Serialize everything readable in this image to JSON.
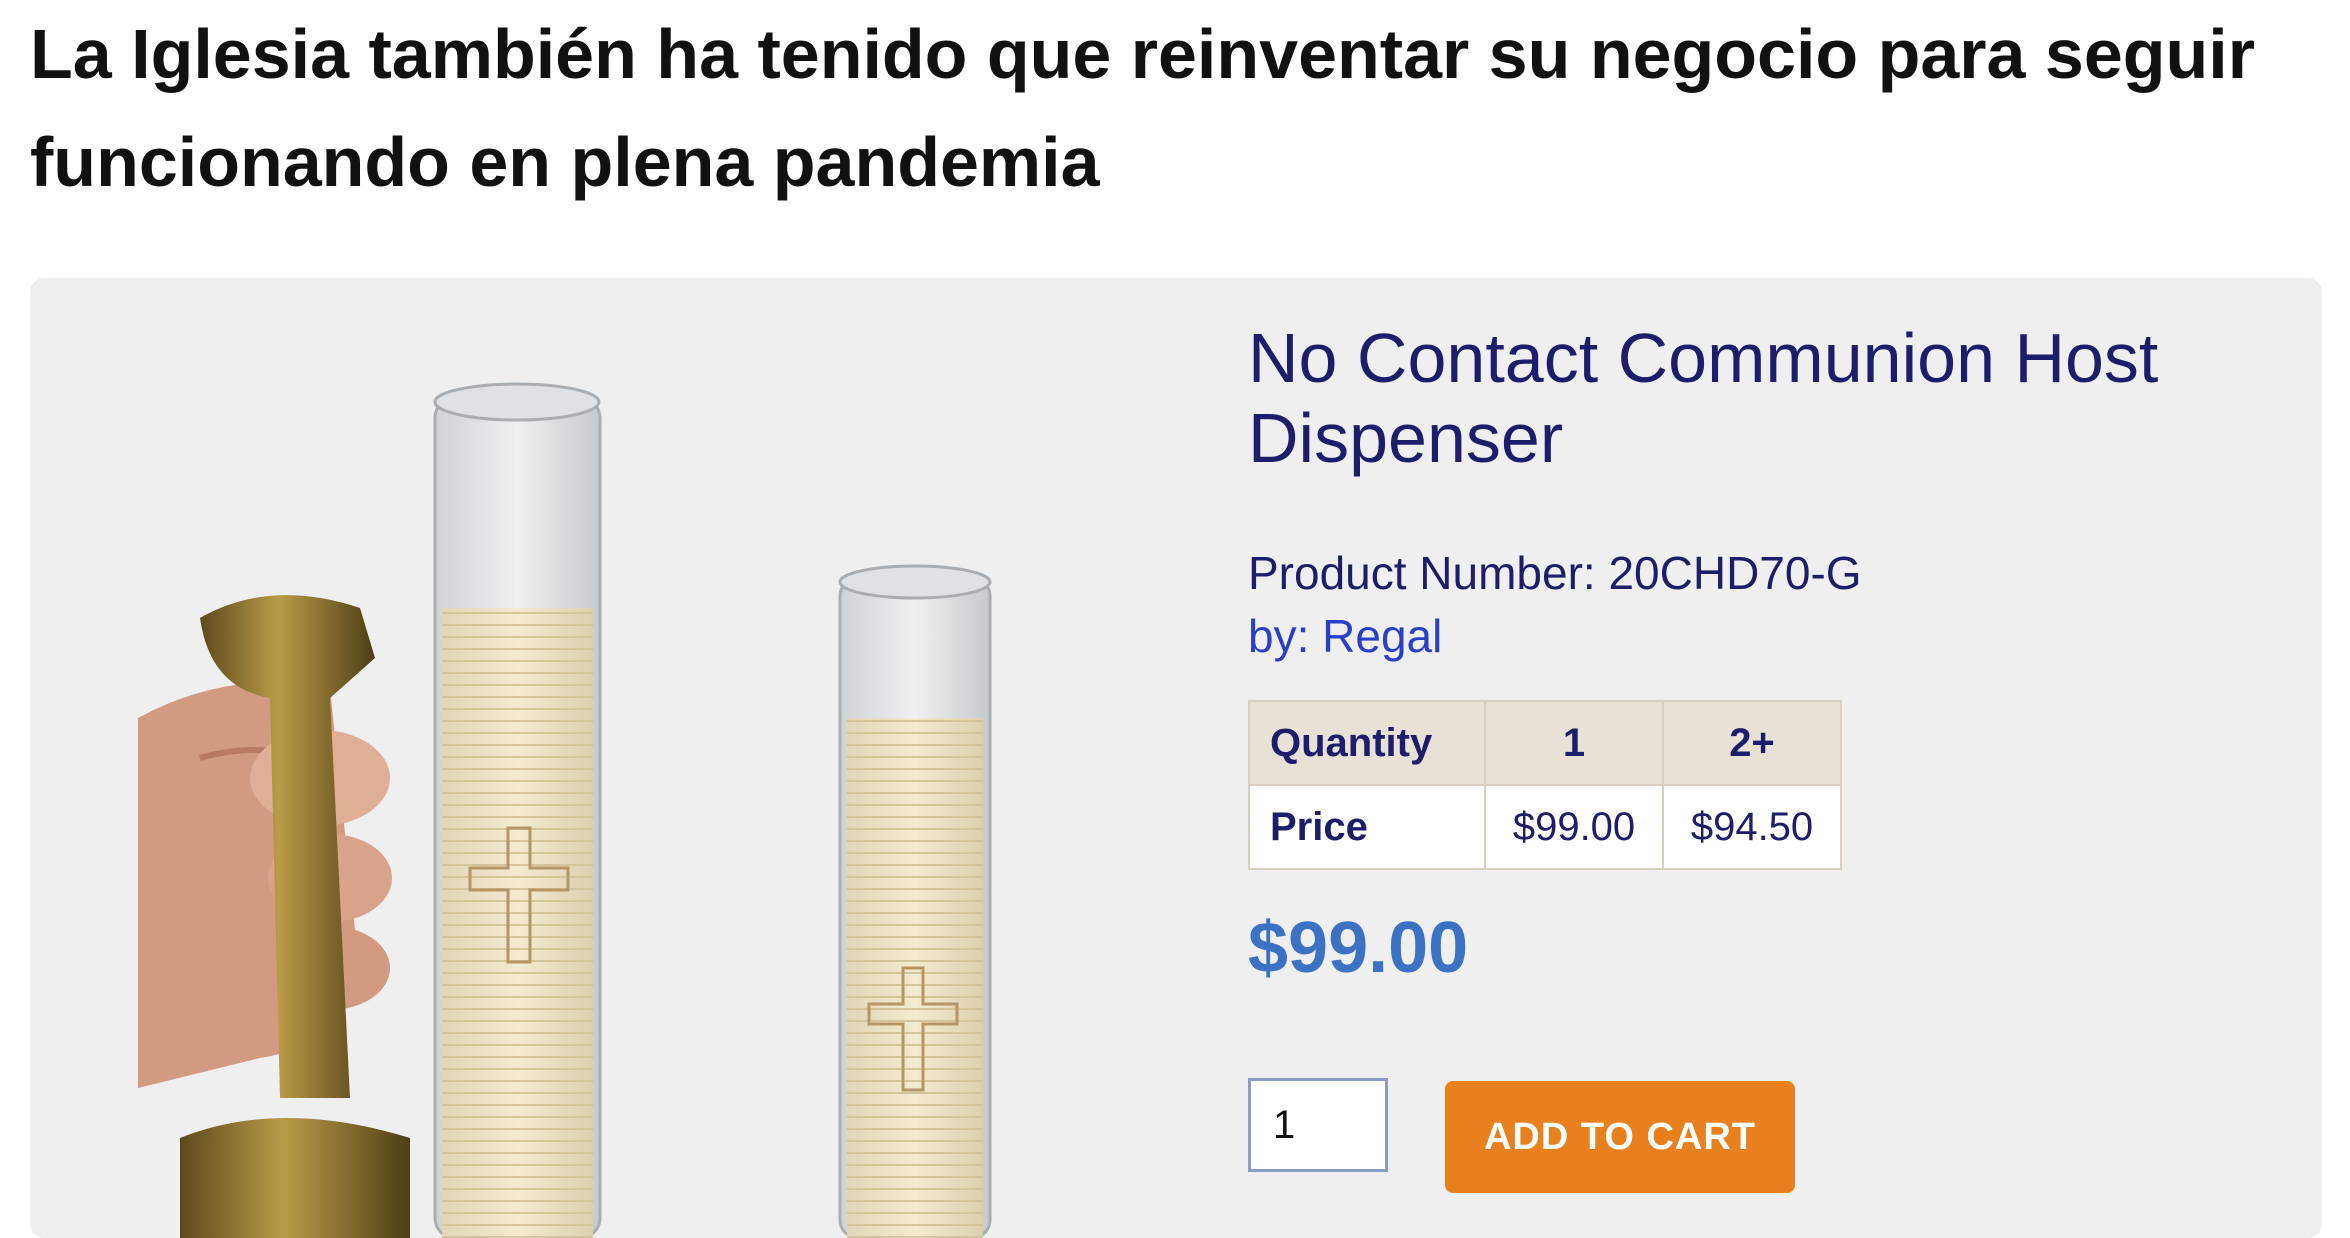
{
  "headline": "La Iglesia también ha tenido que reinventar su negocio para seguir funcionando en plena pandemia",
  "product": {
    "title": "No Contact Communion Host Dispenser",
    "number_label": "Product Number: 20CHD70-G",
    "brand_prefix": "by: ",
    "brand_name": "Regal",
    "pricing": {
      "qty_label": "Quantity",
      "price_label": "Price",
      "tiers": [
        {
          "qty": "1",
          "price": "$99.00"
        },
        {
          "qty": "2+",
          "price": "$94.50"
        }
      ]
    },
    "price": "$99.00",
    "quantity_value": "1",
    "add_to_cart_label": "ADD TO CART"
  },
  "colors": {
    "title": "#1d1d6b",
    "link": "#2a3fc8",
    "price": "#3b72c4",
    "button": "#e8801e",
    "card_bg": "#efefef"
  }
}
